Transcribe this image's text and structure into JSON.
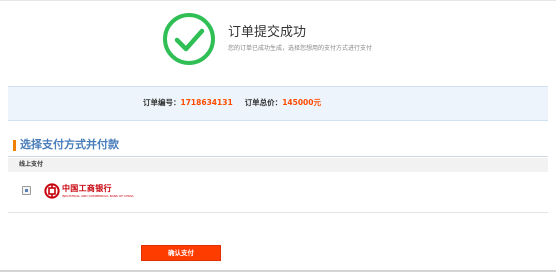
{
  "success": {
    "title": "订单提交成功",
    "subtitle": "您的订单已成功生成，选择您想用的支付方式进行支付"
  },
  "order_info": {
    "number_label": "订单编号：",
    "number_value": "1718634131",
    "total_label": "订单总价：",
    "total_value": "145000元"
  },
  "payment": {
    "section_title": "选择支付方式并付款",
    "online_label": "线上支付",
    "bank_name": "中国工商银行",
    "bank_name_en": "INDUSTRIAL AND COMMERCIAL BANK OF CHINA"
  },
  "confirm_button_label": "确认支付",
  "colors": {
    "success_green": "#2fbf55",
    "accent_orange": "#ff4b00",
    "section_blue": "#4a7ebb",
    "bank_red": "#c7000b"
  }
}
